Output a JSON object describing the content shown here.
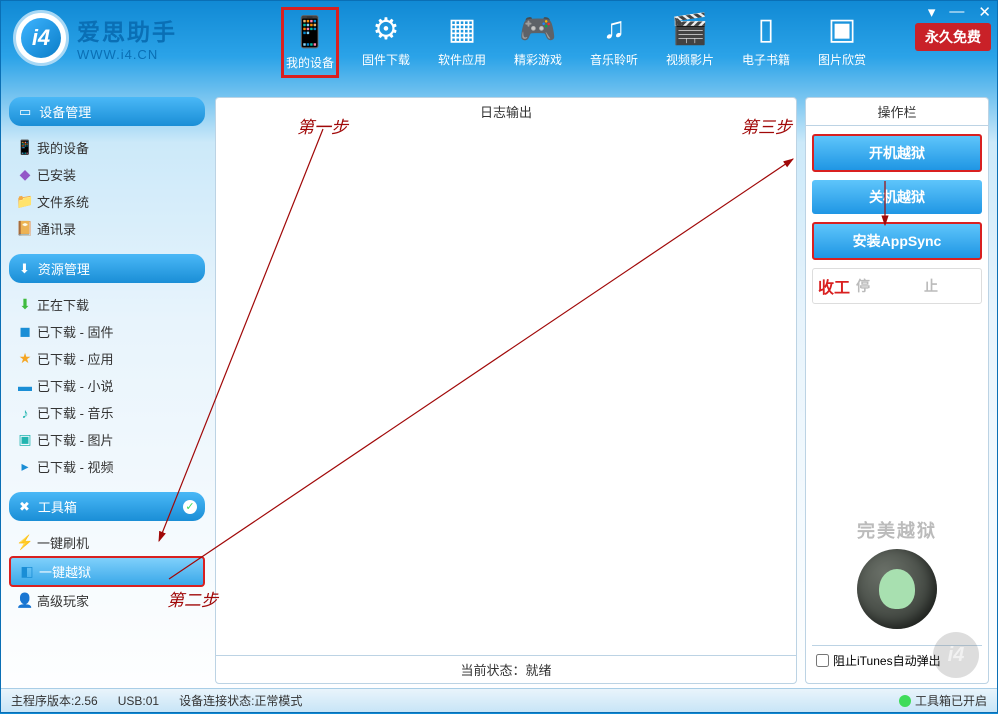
{
  "app": {
    "name_cn": "爱思助手",
    "url": "WWW.i4.CN",
    "logo_text": "i4",
    "badge": "永久免费"
  },
  "toolbar": [
    {
      "label": "我的设备",
      "icon": "📱",
      "active": true
    },
    {
      "label": "固件下载",
      "icon": "⚙"
    },
    {
      "label": "软件应用",
      "icon": "▦"
    },
    {
      "label": "精彩游戏",
      "icon": "🎮"
    },
    {
      "label": "音乐聆听",
      "icon": "♫"
    },
    {
      "label": "视频影片",
      "icon": "🎬"
    },
    {
      "label": "电子书籍",
      "icon": "▯"
    },
    {
      "label": "图片欣赏",
      "icon": "▣"
    }
  ],
  "sidebar": {
    "section1": {
      "title": "设备管理",
      "items": [
        {
          "label": "我的设备",
          "icon": "📱",
          "cls": "c-blue"
        },
        {
          "label": "已安装",
          "icon": "◆",
          "cls": "c-purple"
        },
        {
          "label": "文件系统",
          "icon": "📁",
          "cls": "c-orange"
        },
        {
          "label": "通讯录",
          "icon": "📔",
          "cls": "c-orange"
        }
      ]
    },
    "section2": {
      "title": "资源管理",
      "items": [
        {
          "label": "正在下载",
          "icon": "⬇",
          "cls": "c-green"
        },
        {
          "label": "已下载 - 固件",
          "icon": "◼",
          "cls": "c-blue"
        },
        {
          "label": "已下载 - 应用",
          "icon": "★",
          "cls": "c-orange"
        },
        {
          "label": "已下载 - 小说",
          "icon": "▬",
          "cls": "c-blue"
        },
        {
          "label": "已下载 - 音乐",
          "icon": "♪",
          "cls": "c-teal"
        },
        {
          "label": "已下载 - 图片",
          "icon": "▣",
          "cls": "c-teal"
        },
        {
          "label": "已下载 - 视频",
          "icon": "▸",
          "cls": "c-blue"
        }
      ]
    },
    "section3": {
      "title": "工具箱",
      "items": [
        {
          "label": "一键刷机",
          "icon": "⚡",
          "cls": "c-orange"
        },
        {
          "label": "一键越狱",
          "icon": "◧",
          "cls": "c-blue",
          "selected": true
        },
        {
          "label": "高级玩家",
          "icon": "👤",
          "cls": "c-green"
        }
      ]
    }
  },
  "log": {
    "header": "日志输出",
    "status_prefix": "当前状态：",
    "status_value": "就绪"
  },
  "ops": {
    "header": "操作栏",
    "btn_boot": "开机越狱",
    "btn_shutdown": "关机越狱",
    "btn_appsync": "安装AppSync",
    "btn_stop": "停　止",
    "finish": "收工",
    "jb_text": "完美越狱",
    "itunes_label": "阻止iTunes自动弹出"
  },
  "statusbar": {
    "version_label": "主程序版本:",
    "version": "2.56",
    "usb_label": "USB:",
    "usb": "01",
    "conn_label": "设备连接状态:",
    "conn": "正常模式",
    "tool_status": "工具箱已开启"
  },
  "annotations": {
    "step1": "第一步",
    "step2": "第二步",
    "step3": "第三步"
  },
  "watermark": "i4"
}
